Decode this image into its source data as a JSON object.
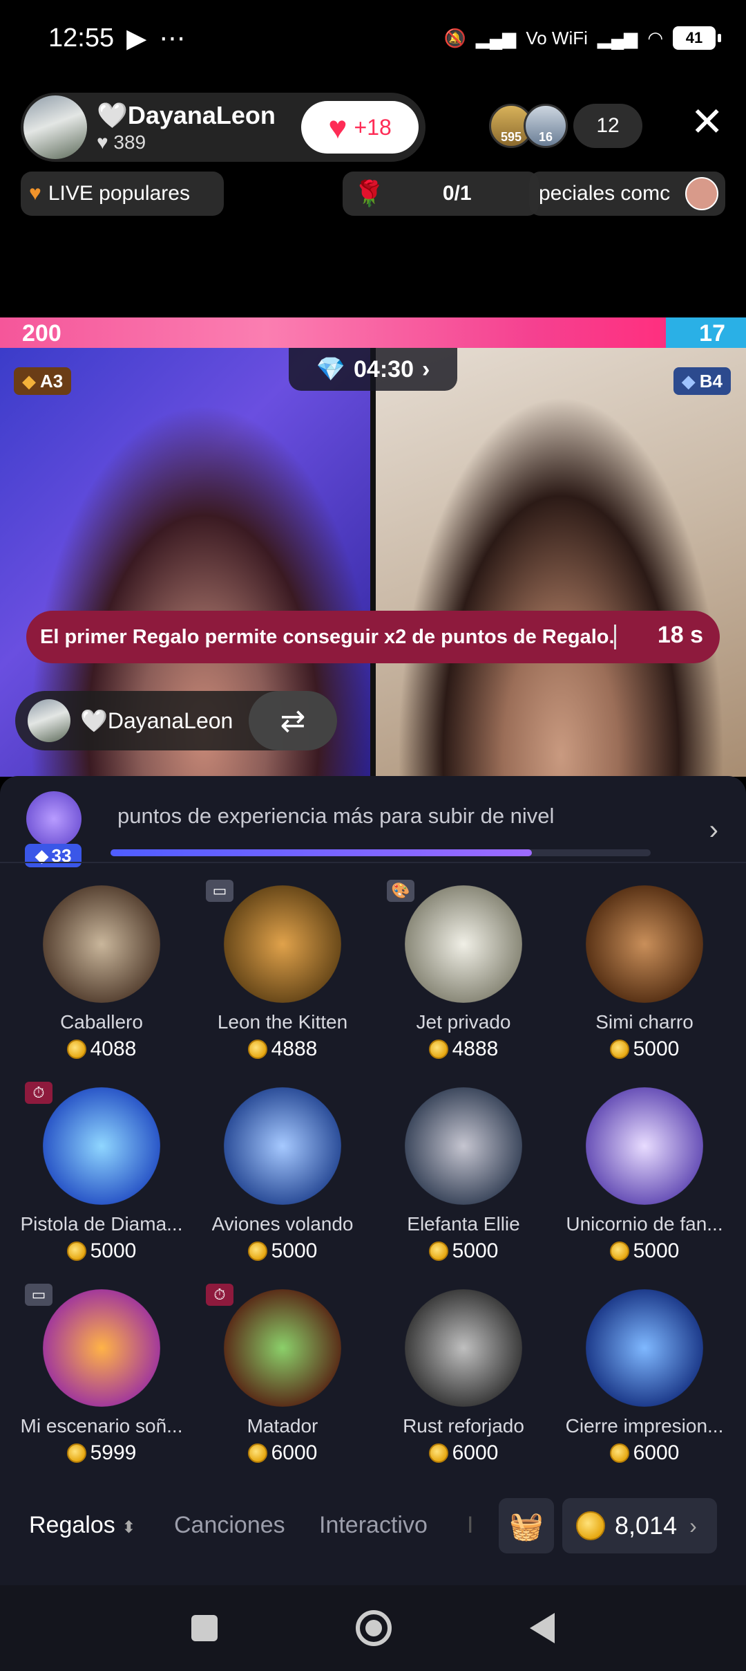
{
  "status_bar": {
    "time": "12:55",
    "icons_left": [
      "video-camera-icon",
      "more-dots-icon"
    ],
    "icons_right": [
      "mute-icon",
      "signal-icon",
      "vowifi-icon",
      "wifi-icon",
      "battery-icon"
    ],
    "vowifi_label": "Vo WiFi",
    "battery": "41"
  },
  "host": {
    "name": "🤍DayanaLeon",
    "likes": "♥ 389",
    "follow_count": "+18"
  },
  "viewers": {
    "badge_a": "595",
    "badge_b": "16",
    "count": "12"
  },
  "pills": {
    "popular": "LIVE populares",
    "rose_count": "0/1",
    "special": "peciales comc"
  },
  "battle": {
    "score_left": "200",
    "score_right": "17",
    "timer": "04:30",
    "rank_left": "A3",
    "rank_right": "B4",
    "banner_text": "El primer Regalo permite conseguir x2 de puntos de Regalo.",
    "banner_seconds": "18 s",
    "chip_name": "🤍DayanaLeon"
  },
  "level": {
    "number": "33",
    "text": "puntos de experiencia más para subir de nivel",
    "progress": 0.78
  },
  "gifts": [
    {
      "name": "Caballero",
      "price": "4088",
      "icon": "knight-horse-icon",
      "tag": ""
    },
    {
      "name": "Leon the Kitten",
      "price": "4888",
      "icon": "lion-icon",
      "tag": "video"
    },
    {
      "name": "Jet privado",
      "price": "4888",
      "icon": "jet-icon",
      "tag": "palette"
    },
    {
      "name": "Simi charro",
      "price": "5000",
      "icon": "trumpet-doll-icon",
      "tag": ""
    },
    {
      "name": "Pistola de Diama...",
      "price": "5000",
      "icon": "diamond-gun-icon",
      "tag": "timer"
    },
    {
      "name": "Aviones volando",
      "price": "5000",
      "icon": "planes-icon",
      "tag": ""
    },
    {
      "name": "Elefanta Ellie",
      "price": "5000",
      "icon": "elephant-icon",
      "tag": ""
    },
    {
      "name": "Unicornio de fan...",
      "price": "5000",
      "icon": "unicorn-icon",
      "tag": ""
    },
    {
      "name": "Mi escenario soñ...",
      "price": "5999",
      "icon": "stage-icon",
      "tag": "video"
    },
    {
      "name": "Matador",
      "price": "6000",
      "icon": "bull-icon",
      "tag": "timer"
    },
    {
      "name": "Rust reforjado",
      "price": "6000",
      "icon": "robot-icon",
      "tag": ""
    },
    {
      "name": "Cierre impresion...",
      "price": "6000",
      "icon": "race-car-icon",
      "tag": ""
    }
  ],
  "tabs": {
    "regalos": "Regalos",
    "canciones": "Canciones",
    "interactivo": "Interactivo"
  },
  "coins": {
    "balance": "8,014"
  },
  "colors": {
    "accent_pink": "#fe2c55",
    "battle_pink": "#f5569a",
    "battle_blue": "#2ab0e6",
    "banner": "#8e1a3d",
    "panel_bg": "#181a26",
    "coin_gold": "#e7a913"
  }
}
